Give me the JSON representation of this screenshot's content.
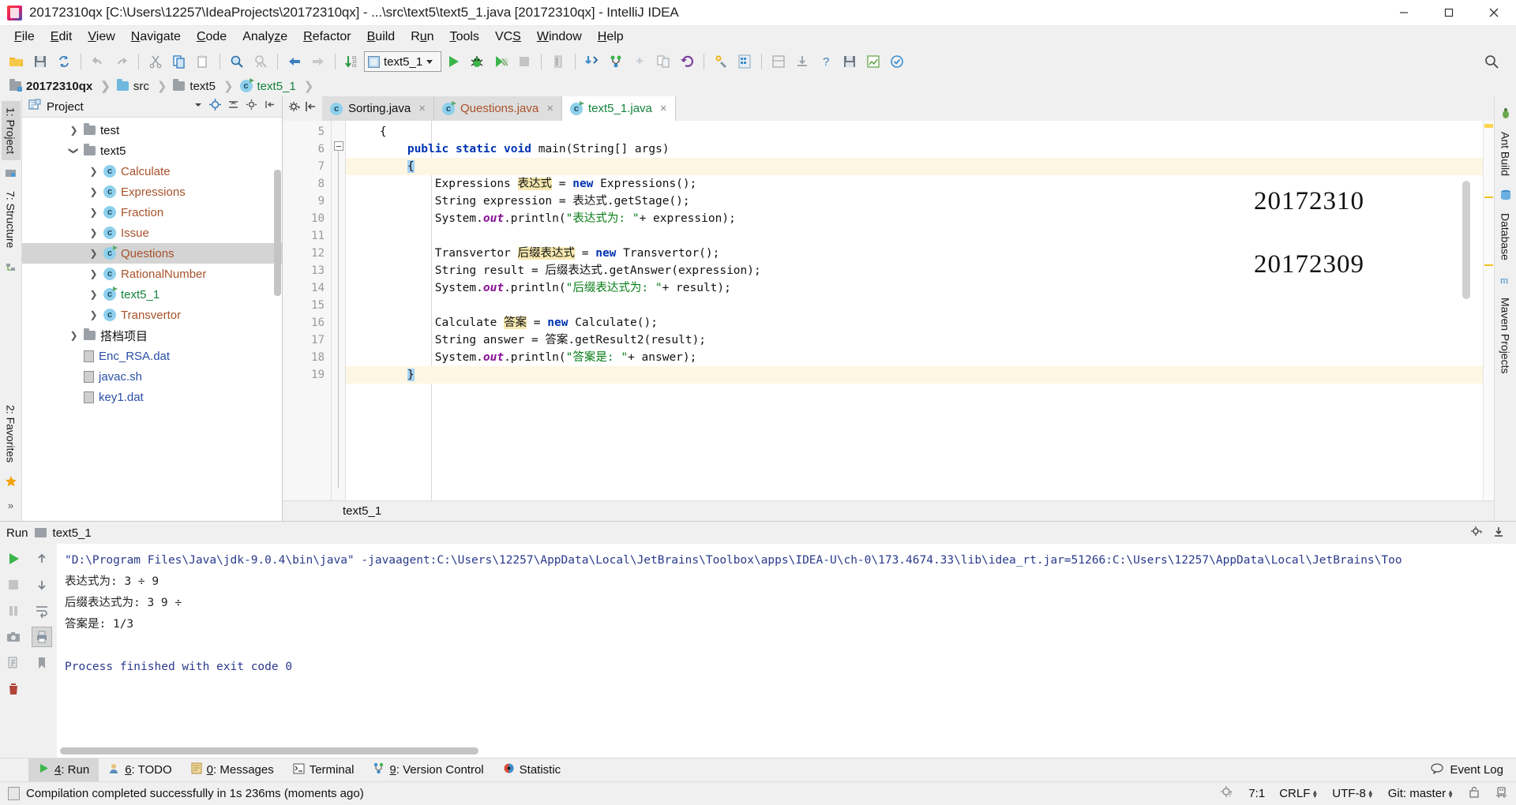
{
  "window": {
    "title": "20172310qx [C:\\Users\\12257\\IdeaProjects\\20172310qx] - ...\\src\\text5\\text5_1.java [20172310qx] - IntelliJ IDEA",
    "minimize_label": "Minimize",
    "maximize_label": "Restore",
    "close_label": "Close"
  },
  "menu": [
    {
      "label": "File",
      "accel": "F"
    },
    {
      "label": "Edit",
      "accel": "E"
    },
    {
      "label": "View",
      "accel": "V"
    },
    {
      "label": "Navigate",
      "accel": "N"
    },
    {
      "label": "Code",
      "accel": "C"
    },
    {
      "label": "Analyze",
      "accel": "z"
    },
    {
      "label": "Refactor",
      "accel": "R"
    },
    {
      "label": "Build",
      "accel": "B"
    },
    {
      "label": "Run",
      "accel": "u"
    },
    {
      "label": "Tools",
      "accel": "T"
    },
    {
      "label": "VCS",
      "accel": "S"
    },
    {
      "label": "Window",
      "accel": "W"
    },
    {
      "label": "Help",
      "accel": "H"
    }
  ],
  "toolbar": {
    "icons": [
      "open-folder-icon",
      "save-all-icon",
      "sync-icon",
      "undo-icon",
      "redo-icon",
      "cut-icon",
      "copy-icon",
      "paste-icon",
      "find-icon",
      "replace-icon",
      "back-icon",
      "forward-icon",
      "sort-icon"
    ],
    "run_config": "text5_1",
    "run_label": "Run",
    "debug_label": "Debug",
    "run_coverage_label": "Run with Coverage",
    "stop_label": "Stop",
    "more_icons": [
      "stop-icon",
      "update-project-icon",
      "commit-icon",
      "patch-icon",
      "compare-icon",
      "rollback-icon",
      "settings-icon",
      "project-structure-icon",
      "layout-icon",
      "help-icon",
      "save-icon",
      "chart-icon",
      "inspect-icon"
    ],
    "search_label": "Search Everywhere"
  },
  "breadcrumb": [
    {
      "label": "20172310qx",
      "icon": "project-folder-icon",
      "style": "bold"
    },
    {
      "label": "src",
      "icon": "source-folder-icon",
      "style": "normal"
    },
    {
      "label": "text5",
      "icon": "package-folder-icon",
      "style": "normal"
    },
    {
      "label": "text5_1",
      "icon": "class-run-icon",
      "style": "green"
    }
  ],
  "left_strip": {
    "project_tab": "1: Project",
    "project_accel": "1",
    "structure_tab": "7: Structure",
    "structure_accel": "7",
    "favorites_tab": "2: Favorites",
    "favorites_accel": "2",
    "favorites_star": "★",
    "more": "»"
  },
  "right_strip": {
    "ant_build": "Ant Build",
    "database": "Database",
    "maven_projects": "Maven Projects"
  },
  "project_panel": {
    "title": "Project",
    "collapse_icon": "chevron-down-icon",
    "locate_icon": "target-icon",
    "collapse_all_icon": "collapse-all-icon",
    "settings_icon": "gear-icon",
    "hide_icon": "hide-icon",
    "tree": [
      {
        "label": "test",
        "type": "folder",
        "indent": 1,
        "twist": "collapsed",
        "selected": false
      },
      {
        "label": "text5",
        "type": "folder",
        "indent": 1,
        "twist": "expanded",
        "selected": false
      },
      {
        "label": "Calculate",
        "type": "class",
        "indent": 2,
        "twist": "collapsed",
        "selected": false
      },
      {
        "label": "Expressions",
        "type": "class",
        "indent": 2,
        "twist": "collapsed",
        "selected": false
      },
      {
        "label": "Fraction",
        "type": "class",
        "indent": 2,
        "twist": "collapsed",
        "selected": false
      },
      {
        "label": "Issue",
        "type": "class",
        "indent": 2,
        "twist": "collapsed",
        "selected": false
      },
      {
        "label": "Questions",
        "type": "class-run",
        "indent": 2,
        "twist": "collapsed",
        "selected": true
      },
      {
        "label": "RationalNumber",
        "type": "class",
        "indent": 2,
        "twist": "collapsed",
        "selected": false
      },
      {
        "label": "text5_1",
        "type": "class-run-green",
        "indent": 2,
        "twist": "collapsed",
        "selected": false
      },
      {
        "label": "Transvertor",
        "type": "class",
        "indent": 2,
        "twist": "collapsed",
        "selected": false
      },
      {
        "label": "搭档项目",
        "type": "folder",
        "indent": 1,
        "twist": "collapsed",
        "selected": false
      },
      {
        "label": "Enc_RSA.dat",
        "type": "file",
        "indent": 1,
        "twist": "none",
        "selected": false
      },
      {
        "label": "javac.sh",
        "type": "file",
        "indent": 1,
        "twist": "none",
        "selected": false
      },
      {
        "label": "key1.dat",
        "type": "file",
        "indent": 1,
        "twist": "none",
        "selected": false
      }
    ]
  },
  "editor": {
    "tabs": [
      {
        "label": "Sorting.java",
        "icon": "java-class-icon",
        "color": "default",
        "active": false,
        "close": "×"
      },
      {
        "label": "Questions.java",
        "icon": "java-class-run-icon",
        "color": "orange",
        "active": false,
        "close": "×"
      },
      {
        "label": "text5_1.java",
        "icon": "java-class-run-icon",
        "color": "green",
        "active": true,
        "close": "×"
      }
    ],
    "gear_icon": "gear-icon",
    "hide_icon": "hide-panel-icon",
    "line_numbers": [
      "5",
      "6",
      "7",
      "8",
      "9",
      "10",
      "11",
      "12",
      "13",
      "14",
      "15",
      "16",
      "17",
      "18",
      "19"
    ],
    "run_marker_line": "6",
    "footer_breadcrumb": "text5_1",
    "watermarks": [
      "20172310",
      "20172309"
    ],
    "lines": [
      {
        "n": "5",
        "segments": [
          {
            "t": "    {",
            "c": "plain"
          }
        ]
      },
      {
        "n": "6",
        "segments": [
          {
            "t": "        ",
            "c": "plain"
          },
          {
            "t": "public static void",
            "c": "kw"
          },
          {
            "t": " main(String[] args)",
            "c": "plain"
          }
        ]
      },
      {
        "n": "7",
        "segments": [
          {
            "t": "        ",
            "c": "plain"
          },
          {
            "t": "{",
            "c": "cursor"
          }
        ]
      },
      {
        "n": "8",
        "segments": [
          {
            "t": "            Expressions ",
            "c": "plain"
          },
          {
            "t": "表达式",
            "c": "hlvar"
          },
          {
            "t": " = ",
            "c": "plain"
          },
          {
            "t": "new",
            "c": "kw"
          },
          {
            "t": " Expressions();",
            "c": "plain"
          }
        ]
      },
      {
        "n": "9",
        "segments": [
          {
            "t": "            String expression = 表达式.getStage();",
            "c": "plain"
          }
        ]
      },
      {
        "n": "10",
        "segments": [
          {
            "t": "            System.",
            "c": "plain"
          },
          {
            "t": "out",
            "c": "fld"
          },
          {
            "t": ".println(",
            "c": "plain"
          },
          {
            "t": "\"表达式为: \"",
            "c": "str"
          },
          {
            "t": "+ expression);",
            "c": "plain"
          }
        ]
      },
      {
        "n": "11",
        "segments": [
          {
            "t": "",
            "c": "plain"
          }
        ]
      },
      {
        "n": "12",
        "segments": [
          {
            "t": "            Transvertor ",
            "c": "plain"
          },
          {
            "t": "后缀表达式",
            "c": "hlvar"
          },
          {
            "t": " = ",
            "c": "plain"
          },
          {
            "t": "new",
            "c": "kw"
          },
          {
            "t": " Transvertor();",
            "c": "plain"
          }
        ]
      },
      {
        "n": "13",
        "segments": [
          {
            "t": "            String result = 后缀表达式.getAnswer(expression);",
            "c": "plain"
          }
        ]
      },
      {
        "n": "14",
        "segments": [
          {
            "t": "            System.",
            "c": "plain"
          },
          {
            "t": "out",
            "c": "fld"
          },
          {
            "t": ".println(",
            "c": "plain"
          },
          {
            "t": "\"后缀表达式为: \"",
            "c": "str"
          },
          {
            "t": "+ result);",
            "c": "plain"
          }
        ]
      },
      {
        "n": "15",
        "segments": [
          {
            "t": "",
            "c": "plain"
          }
        ]
      },
      {
        "n": "16",
        "segments": [
          {
            "t": "            Calculate ",
            "c": "plain"
          },
          {
            "t": "答案",
            "c": "hlvar"
          },
          {
            "t": " = ",
            "c": "plain"
          },
          {
            "t": "new",
            "c": "kw"
          },
          {
            "t": " Calculate();",
            "c": "plain"
          }
        ]
      },
      {
        "n": "17",
        "segments": [
          {
            "t": "            String answer = 答案.getResult2(result);",
            "c": "plain"
          }
        ]
      },
      {
        "n": "18",
        "segments": [
          {
            "t": "            System.",
            "c": "plain"
          },
          {
            "t": "out",
            "c": "fld"
          },
          {
            "t": ".println(",
            "c": "plain"
          },
          {
            "t": "\"答案是: \"",
            "c": "str"
          },
          {
            "t": "+ answer);",
            "c": "plain"
          }
        ]
      },
      {
        "n": "19",
        "segments": [
          {
            "t": "        ",
            "c": "plain"
          },
          {
            "t": "}",
            "c": "cursor"
          }
        ]
      }
    ]
  },
  "run_window": {
    "title": "Run",
    "tab_label": "text5_1",
    "settings_icon": "gear-icon",
    "hide_icon": "hide-icon",
    "actions": [
      "rerun-icon",
      "stop-icon",
      "pause-icon",
      "camera-icon",
      "export-icon",
      "trash-icon"
    ],
    "actions2": [
      "scroll-up-icon",
      "scroll-down-icon",
      "soft-wrap-icon",
      "print-icon",
      "bookmark-icon"
    ],
    "console": [
      {
        "text": "\"D:\\Program Files\\Java\\jdk-9.0.4\\bin\\java\" -javaagent:C:\\Users\\12257\\AppData\\Local\\JetBrains\\Toolbox\\apps\\IDEA-U\\ch-0\\173.4674.33\\lib\\idea_rt.jar=51266:C:\\Users\\12257\\AppData\\Local\\JetBrains\\Too",
        "style": "blue"
      },
      {
        "text": "表达式为: 3 ÷ 9",
        "style": "normal"
      },
      {
        "text": "后缀表达式为: 3 9 ÷",
        "style": "normal"
      },
      {
        "text": "答案是: 1/3",
        "style": "normal"
      },
      {
        "text": "",
        "style": "normal"
      },
      {
        "text": "Process finished with exit code 0",
        "style": "blue"
      }
    ]
  },
  "bottom_bar": {
    "tabs": [
      {
        "label": "4: Run",
        "accel": "4",
        "icon": "run-icon",
        "active": true
      },
      {
        "label": "6: TODO",
        "accel": "6",
        "icon": "todo-icon",
        "active": false
      },
      {
        "label": "0: Messages",
        "accel": "0",
        "icon": "messages-icon",
        "active": false
      },
      {
        "label": "Terminal",
        "accel": "",
        "icon": "terminal-icon",
        "active": false
      },
      {
        "label": "9: Version Control",
        "accel": "9",
        "icon": "vcs-icon",
        "active": false
      },
      {
        "label": "Statistic",
        "accel": "",
        "icon": "statistic-icon",
        "active": false
      }
    ],
    "event_log": "Event Log",
    "event_log_icon": "balloon-icon"
  },
  "status_bar": {
    "message": "Compilation completed successfully in 1s 236ms (moments ago)",
    "message_icon": "build-icon",
    "inspection_icon": "inspections-icon",
    "caret_position": "7:1",
    "line_separator": "CRLF",
    "encoding": "UTF-8",
    "branch": "Git: master",
    "lock_icon": "unlock-icon",
    "memory_icon": "hector-icon"
  },
  "colors": {
    "accent_blue": "#2a4fa8",
    "keyword_blue": "#0033b3",
    "string_green": "#067d17",
    "field_purple": "#871094",
    "class_orange": "#a8522a",
    "run_green": "#14833b",
    "highlight_yellow": "#f7e9b0",
    "caret_line": "#fdf6e3",
    "chrome_gray": "#f0f0f0"
  }
}
